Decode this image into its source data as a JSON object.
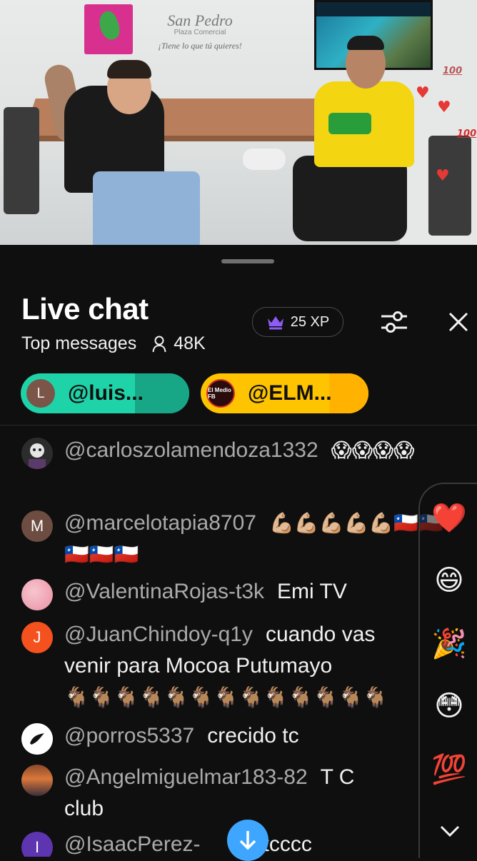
{
  "video": {
    "logo_main": "San Pedro",
    "logo_sub": "Plaza Comercial",
    "logo_slogan": "¡Tiene lo que tú quieres!",
    "overlay_reactions": [
      "heart",
      "heart",
      "hundred",
      "hundred",
      "heart"
    ]
  },
  "chat": {
    "title": "Live chat",
    "filter_label": "Top messages",
    "viewer_count": "48K",
    "xp_label": "25 XP",
    "pinned": [
      {
        "avatar_letter": "L",
        "label": "@luis..."
      },
      {
        "avatar_letter": "",
        "avatar_text": "El Medio FB",
        "label": "@ELM..."
      }
    ]
  },
  "messages": [
    {
      "avatar": "",
      "author": "@carloszolamendoza1332",
      "text": "",
      "emoji": "😱😱😱😱"
    },
    {
      "avatar": "M",
      "author": "@marcelotapia8707",
      "text": "",
      "emoji": "💪🏼💪🏼💪🏼💪🏼💪🏼🇨🇱🇨🇱🇨🇱🇨🇱🇨🇱"
    },
    {
      "avatar": "",
      "author": "@ValentinaRojas-t3k",
      "text": "Emi TV"
    },
    {
      "avatar": "J",
      "author": "@JuanChindoy-q1y",
      "text_line1": "cuando vas",
      "text_line2": "venir para Mocoa Putumayo",
      "emoji": "🐐🐐🐐🐐🐐🐐🐐🐐🐐🐐🐐🐐🐐"
    },
    {
      "avatar": "",
      "author": "@porros5337",
      "text": "crecido tc"
    },
    {
      "avatar": "",
      "author": "@Angelmiguelmar183-82",
      "text": "T C",
      "text_line2": "club"
    },
    {
      "avatar": "I",
      "author": "@IsaacPerez-",
      "text": "tcccc"
    }
  ],
  "reactions": [
    "❤️",
    "😄",
    "🎉",
    "😳",
    "💯"
  ],
  "colors": {
    "green_pin": "#1fd3a8",
    "yellow_pin": "#ffc400",
    "accent_blue": "#3ea6ff",
    "crown_purple": "#8e5cf5"
  }
}
